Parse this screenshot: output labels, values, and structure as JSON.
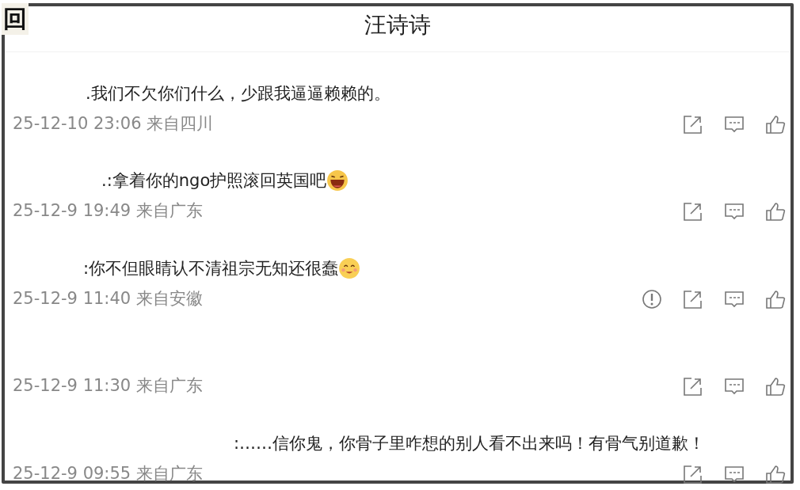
{
  "corner_label": "回",
  "title": "汪诗诗",
  "comments": [
    {
      "text": ".我们不欠你们什么，少跟我逼逼赖赖的。",
      "kind": "plain",
      "time": "25-12-10 23:06 来自四川",
      "report": false
    },
    {
      "text": ".:拿着你的ngo护照滚回英国吧",
      "kind": "laugh",
      "time": "25-12-9 19:49 来自广东",
      "report": false
    },
    {
      "text": ":你不但眼睛认不清祖宗无知还很蠢",
      "kind": "smile",
      "time": "25-12-9 11:40 来自安徽",
      "report": true
    },
    {
      "kind": "plain",
      "time": "25-12-9 11:30 来自广东",
      "report": false
    },
    {
      "text": ":……信你鬼，你骨子里咋想的别人看不出来吗！有骨气别道歉！",
      "kind": "plain",
      "time": "25-12-9 09:55 来自广东",
      "report": false
    }
  ]
}
